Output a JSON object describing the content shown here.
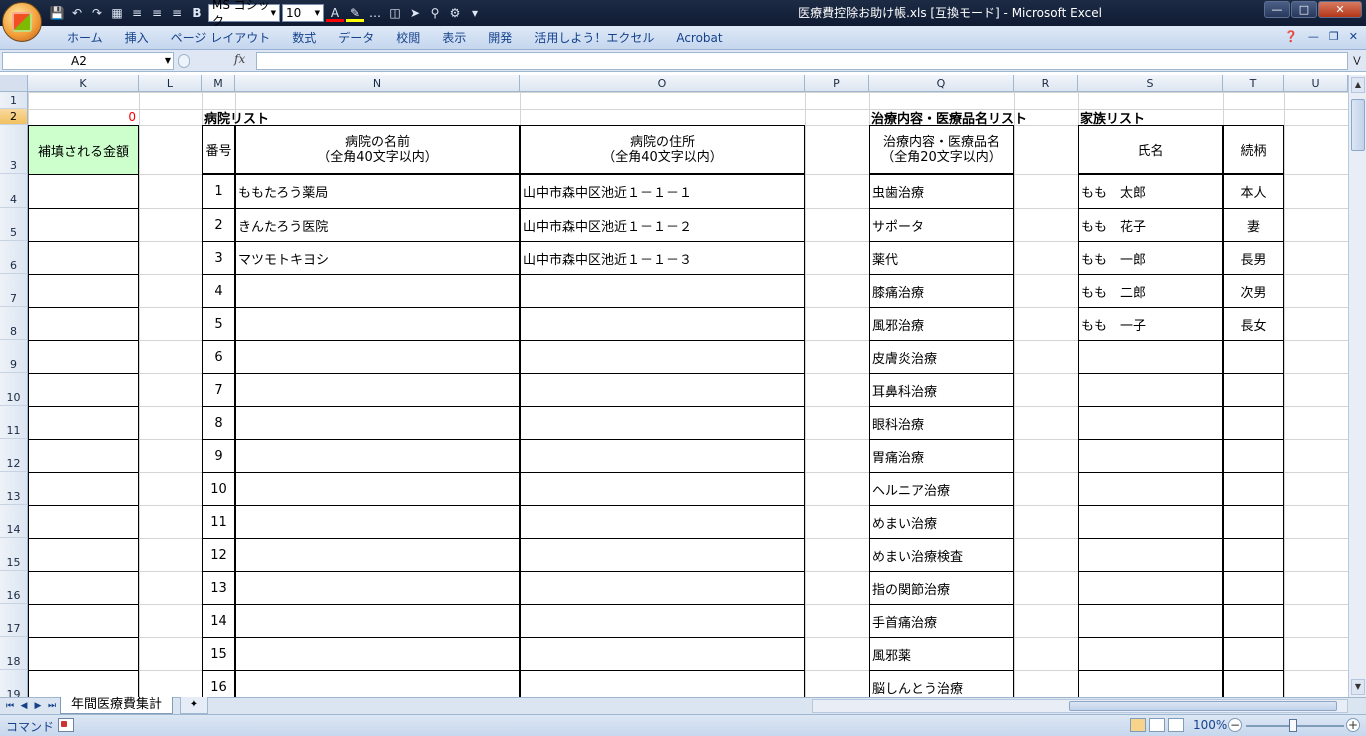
{
  "window": {
    "title": "医療費控除お助け帳.xls  [互換モード] - Microsoft Excel",
    "min_label": "—",
    "max_label": "□",
    "close_label": "✕"
  },
  "qat": {
    "font_name": "MS ゴシック",
    "font_size": "10"
  },
  "ribbon": {
    "tabs": [
      "ホーム",
      "挿入",
      "ページ レイアウト",
      "数式",
      "データ",
      "校閲",
      "表示",
      "開発",
      "活用しよう！エクセル",
      "Acrobat"
    ]
  },
  "formula": {
    "name_box": "A2",
    "fx": "fx",
    "content": ""
  },
  "columns": [
    "K",
    "L",
    "M",
    "N",
    "O",
    "P",
    "Q",
    "R",
    "S",
    "T",
    "U"
  ],
  "rows": [
    "1",
    "2",
    "3",
    "4",
    "5",
    "6",
    "7",
    "8",
    "9",
    "10",
    "11",
    "12",
    "13",
    "14",
    "15",
    "16",
    "17",
    "18",
    "19"
  ],
  "cells": {
    "k2_value": "0",
    "k3_header": "補填される金額"
  },
  "hospital_list": {
    "title": "病院リスト",
    "header_num": "番号",
    "header_name": [
      "病院の名前",
      "（全角40文字以内）"
    ],
    "header_address": [
      "病院の住所",
      "（全角40文字以内）"
    ],
    "rows": [
      {
        "num": "1",
        "name": "ももたろう薬局",
        "address": "山中市森中区池近１－１－１"
      },
      {
        "num": "2",
        "name": "きんたろう医院",
        "address": "山中市森中区池近１－１－２"
      },
      {
        "num": "3",
        "name": "マツモトキヨシ",
        "address": "山中市森中区池近１－１－３"
      },
      {
        "num": "4",
        "name": "",
        "address": ""
      },
      {
        "num": "5",
        "name": "",
        "address": ""
      },
      {
        "num": "6",
        "name": "",
        "address": ""
      },
      {
        "num": "7",
        "name": "",
        "address": ""
      },
      {
        "num": "8",
        "name": "",
        "address": ""
      },
      {
        "num": "9",
        "name": "",
        "address": ""
      },
      {
        "num": "10",
        "name": "",
        "address": ""
      },
      {
        "num": "11",
        "name": "",
        "address": ""
      },
      {
        "num": "12",
        "name": "",
        "address": ""
      },
      {
        "num": "13",
        "name": "",
        "address": ""
      },
      {
        "num": "14",
        "name": "",
        "address": ""
      },
      {
        "num": "15",
        "name": "",
        "address": ""
      },
      {
        "num": "16",
        "name": "",
        "address": ""
      }
    ]
  },
  "treatment_list": {
    "title": "治療内容・医療品名リスト",
    "header": [
      "治療内容・医療品名",
      "（全角20文字以内）"
    ],
    "items": [
      "虫歯治療",
      "サポータ",
      "薬代",
      "膝痛治療",
      "風邪治療",
      "皮膚炎治療",
      "耳鼻科治療",
      "眼科治療",
      "胃痛治療",
      "ヘルニア治療",
      "めまい治療",
      "めまい治療検査",
      "指の関節治療",
      "手首痛治療",
      "風邪薬",
      "脳しんとう治療"
    ]
  },
  "family_list": {
    "title": "家族リスト",
    "header_name": "氏名",
    "header_relation": "続柄",
    "rows": [
      {
        "name": "もも　太郎",
        "relation": "本人"
      },
      {
        "name": "もも　花子",
        "relation": "妻"
      },
      {
        "name": "もも　一郎",
        "relation": "長男"
      },
      {
        "name": "もも　二郎",
        "relation": "次男"
      },
      {
        "name": "もも　一子",
        "relation": "長女"
      },
      {
        "name": "",
        "relation": ""
      },
      {
        "name": "",
        "relation": ""
      },
      {
        "name": "",
        "relation": ""
      },
      {
        "name": "",
        "relation": ""
      },
      {
        "name": "",
        "relation": ""
      },
      {
        "name": "",
        "relation": ""
      },
      {
        "name": "",
        "relation": ""
      },
      {
        "name": "",
        "relation": ""
      },
      {
        "name": "",
        "relation": ""
      },
      {
        "name": "",
        "relation": ""
      },
      {
        "name": "",
        "relation": ""
      }
    ]
  },
  "sheet_tabs": {
    "active": "年間医療費集計"
  },
  "status": {
    "mode": "コマンド",
    "zoom": "100%"
  },
  "colors": {
    "accent_red": "#ff0000",
    "header_fill": "#ccffcc",
    "selection": "#f1c15f"
  }
}
